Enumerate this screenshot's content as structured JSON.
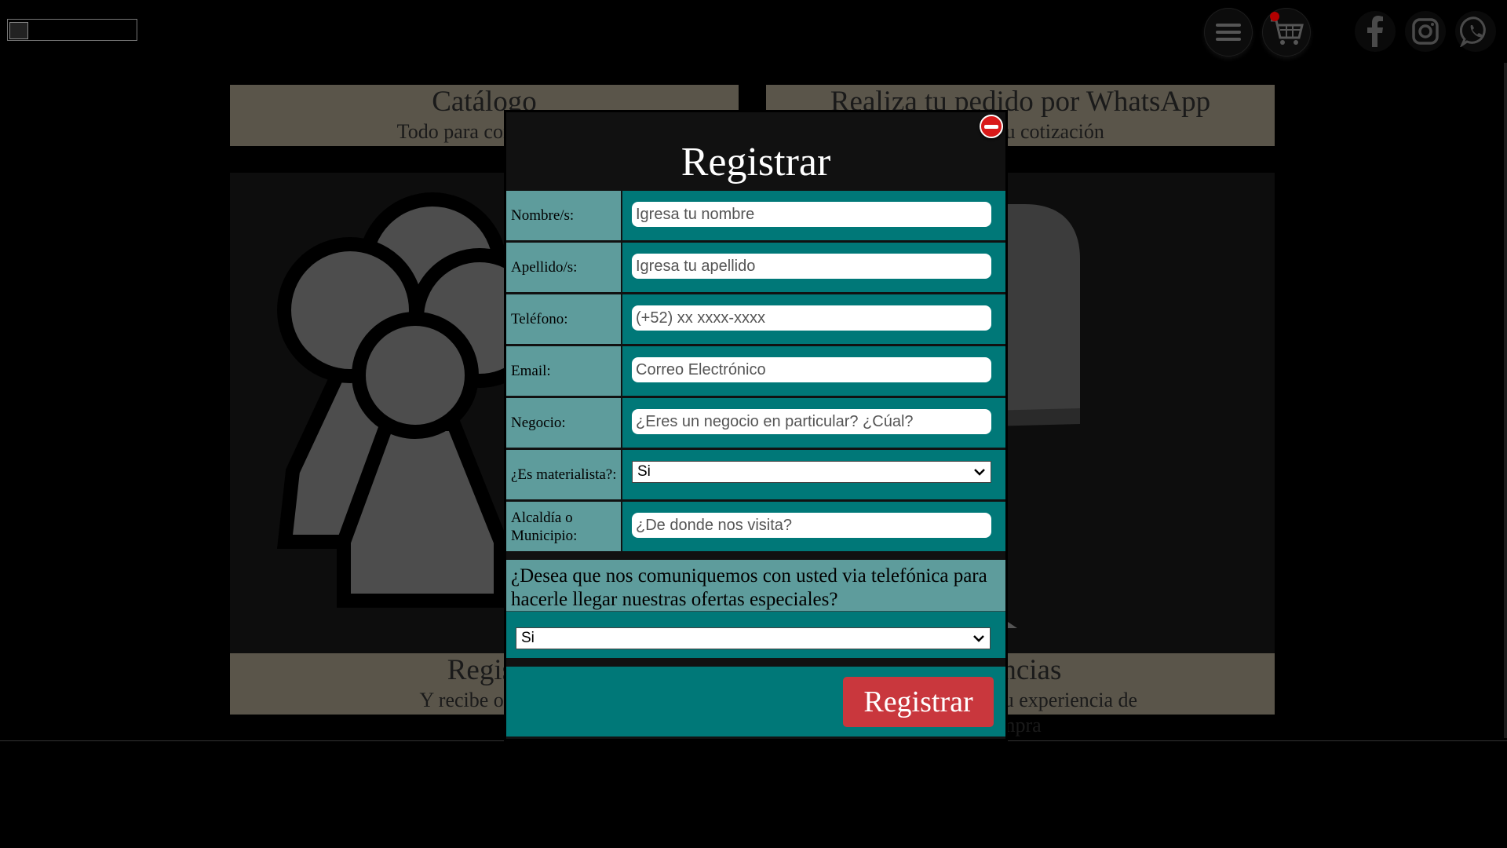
{
  "background": {
    "cards": [
      {
        "title": "Catálogo",
        "subtitle": "Todo para construír o"
      },
      {
        "title": "Realiza tu pedido por WhatsApp",
        "subtitle": "olicitar tu cotización"
      },
      {
        "title": "Regist",
        "subtitle": "Y recibe ofertas"
      },
      {
        "title": "rencias",
        "subtitle": "mo ha sido tu experiencia de",
        "subtitle2": "mpra"
      }
    ]
  },
  "header": {
    "menu_icon": "hamburger-menu-icon",
    "cart_icon": "shopping-cart-icon",
    "social": [
      "facebook-icon",
      "instagram-icon",
      "whatsapp-icon"
    ]
  },
  "modal": {
    "title": "Registrar",
    "fields": [
      {
        "label": "Nombre/s:",
        "placeholder": "Igresa tu nombre"
      },
      {
        "label": "Apellido/s:",
        "placeholder": "Igresa tu apellido"
      },
      {
        "label": "Teléfono:",
        "placeholder": "(+52) xx xxxx-xxxx"
      },
      {
        "label": "Email:",
        "placeholder": "Correo Electrónico"
      },
      {
        "label": "Negocio:",
        "placeholder": "¿Eres un negocio en particular? ¿Cúal?"
      },
      {
        "label": "¿Es materialista?:",
        "selected": "Si"
      },
      {
        "label": "Alcaldía o Municipio:",
        "placeholder": "¿De donde nos visita?"
      }
    ],
    "question": "¿Desea que nos comuniquemos con usted via telefónica para hacerle llegar nuestras ofertas especiales?",
    "question_selected": "Si",
    "submit_label": "Registrar"
  },
  "colors": {
    "teal": "#007878",
    "label_teal": "#5e9c9c",
    "submit_red": "#c9373d",
    "close_red": "#d91a1a"
  }
}
